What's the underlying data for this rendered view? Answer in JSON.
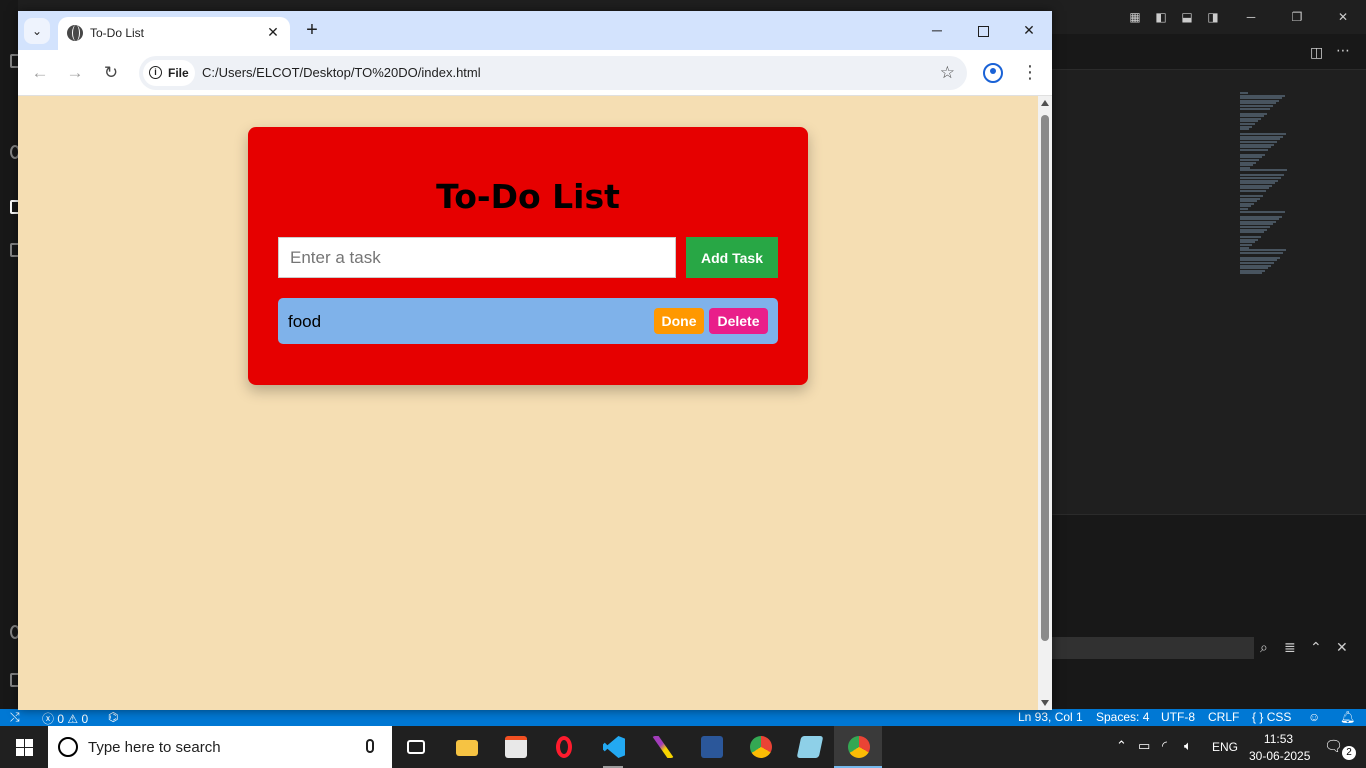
{
  "browser": {
    "tab_title": "To-Do List",
    "site_chip": "File",
    "url": "C:/Users/ELCOT/Desktop/TO%20DO/index.html"
  },
  "app": {
    "heading": "To-Do List",
    "input_placeholder": "Enter a task",
    "add_label": "Add Task",
    "tasks": [
      {
        "text": "food",
        "done_label": "Done",
        "delete_label": "Delete"
      }
    ],
    "colors": {
      "page_bg": "#f5deb3",
      "card_bg": "#e60000",
      "add_button": "#28a745",
      "task_bg": "#7fb2ea",
      "done_button": "#ff9800",
      "delete_button": "#e91e8a"
    }
  },
  "vscode_status": {
    "errors": "0",
    "warnings": "0",
    "cursor": "Ln 93, Col 1",
    "spaces": "Spaces: 4",
    "encoding": "UTF-8",
    "eol": "CRLF",
    "language": "CSS"
  },
  "taskbar": {
    "search_placeholder": "Type here to search",
    "language": "ENG",
    "time": "11:53",
    "date": "30-06-2025",
    "notification_count": "2"
  }
}
